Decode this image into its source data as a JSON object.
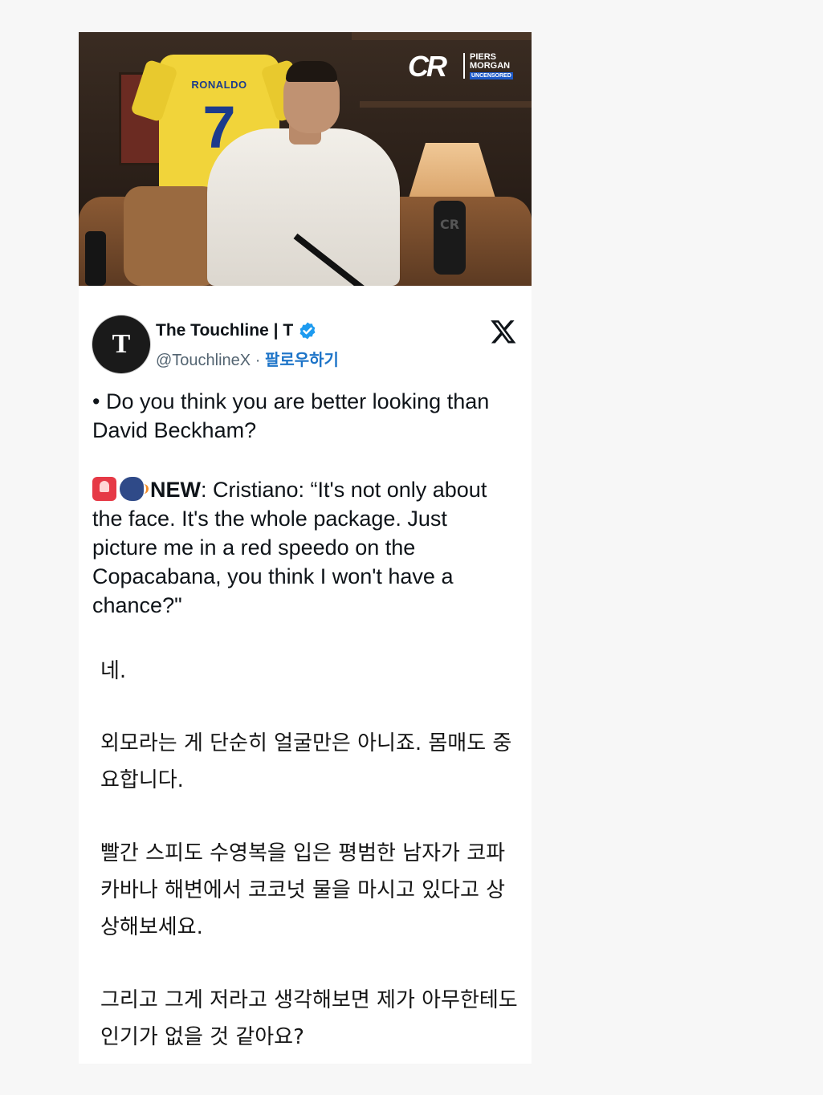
{
  "thumbnail": {
    "jersey_name": "RONALDO",
    "jersey_number": "7",
    "channel_logo": "CR",
    "show_name_line1": "PIERS",
    "show_name_line2": "MORGAN",
    "show_badge": "UNCENSORED"
  },
  "tweet": {
    "avatar_letter": "T",
    "display_name": "The Touchline | T",
    "verified_icon": "verified-badge-icon",
    "handle": "@TouchlineX",
    "separator": " · ",
    "follow_label": "팔로우하기",
    "platform_icon": "x-logo-icon",
    "question": "• Do you think you are better looking than David Beckham?",
    "new_label": "NEW",
    "quote": ": Cristiano: “It's not only about the face. It's the whole package. Just picture me in a red speedo on the Copacabana, you think I won't have a chance?\""
  },
  "translation": {
    "p1": "네.",
    "p2": "외모라는 게 단순히 얼굴만은 아니죠. 몸매도 중요합니다.",
    "p3": "빨간 스피도 수영복을 입은 평범한 남자가 코파카바나 해변에서 코코넛 물을 마시고 있다고 상상해보세요.",
    "p4": "그리고 그게 저라고 생각해보면 제가 아무한테도 인기가 없을 것 같아요?"
  },
  "colors": {
    "background": "#f7f7f7",
    "card": "#ffffff",
    "follow_blue": "#1d74c8",
    "verified_blue": "#1d9bf0"
  }
}
